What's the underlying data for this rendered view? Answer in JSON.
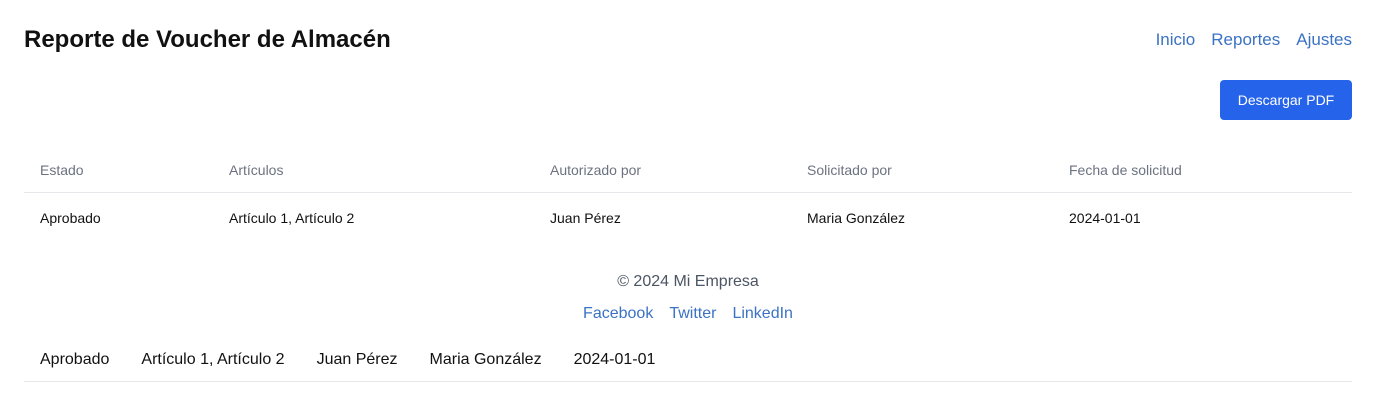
{
  "header": {
    "title": "Reporte de Voucher de Almacén",
    "nav": [
      "Inicio",
      "Reportes",
      "Ajustes"
    ]
  },
  "toolbar": {
    "download_label": "Descargar PDF"
  },
  "table": {
    "columns": [
      "Estado",
      "Artículos",
      "Autorizado por",
      "Solicitado por",
      "Fecha de solicitud"
    ],
    "rows": [
      [
        "Aprobado",
        "Artículo 1, Artículo 2",
        "Juan Pérez",
        "Maria González",
        "2024-01-01"
      ]
    ]
  },
  "footer": {
    "copyright": "© 2024 Mi Empresa",
    "links": [
      "Facebook",
      "Twitter",
      "LinkedIn"
    ]
  },
  "extra_row": [
    "Aprobado",
    "Artículo 1, Artículo 2",
    "Juan Pérez",
    "Maria González",
    "2024-01-01"
  ]
}
